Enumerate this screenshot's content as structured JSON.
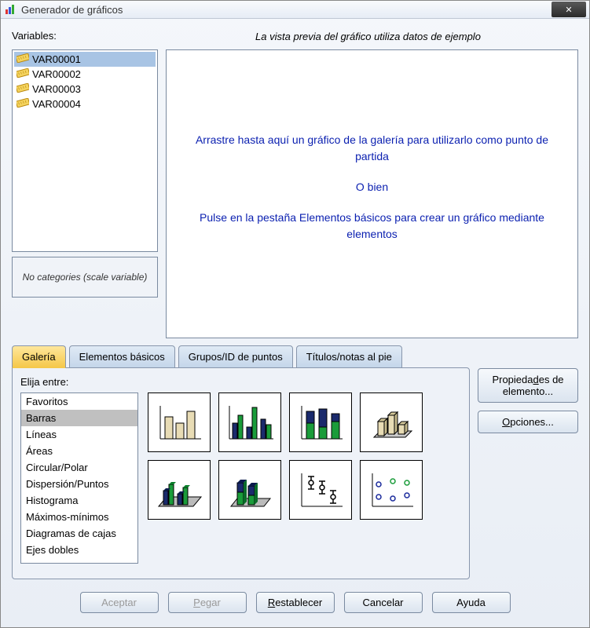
{
  "window": {
    "title": "Generador de gráficos"
  },
  "labels": {
    "variables": "Variables:",
    "preview_hint": "La vista previa del gráfico utiliza datos de ejemplo",
    "no_categories": "No categories (scale variable)",
    "choose_among": "Elija entre:"
  },
  "variables": [
    {
      "name": "VAR00001",
      "selected": true
    },
    {
      "name": "VAR00002",
      "selected": false
    },
    {
      "name": "VAR00003",
      "selected": false
    },
    {
      "name": "VAR00004",
      "selected": false
    }
  ],
  "preview_messages": {
    "drag": "Arrastre hasta aquí un gráfico de la galería para utilizarlo como punto de partida",
    "or": "O bien",
    "click": "Pulse en la pestaña Elementos básicos para crear un gráfico mediante elementos"
  },
  "tabs": [
    {
      "label": "Galería",
      "active": true
    },
    {
      "label": "Elementos básicos",
      "active": false
    },
    {
      "label": "Grupos/ID de puntos",
      "active": false
    },
    {
      "label": "Títulos/notas al pie",
      "active": false
    }
  ],
  "gallery_types": [
    {
      "label": "Favoritos",
      "selected": false
    },
    {
      "label": "Barras",
      "selected": true
    },
    {
      "label": "Líneas",
      "selected": false
    },
    {
      "label": "Áreas",
      "selected": false
    },
    {
      "label": "Circular/Polar",
      "selected": false
    },
    {
      "label": "Dispersión/Puntos",
      "selected": false
    },
    {
      "label": "Histograma",
      "selected": false
    },
    {
      "label": "Máximos-mínimos",
      "selected": false
    },
    {
      "label": "Diagramas de cajas",
      "selected": false
    },
    {
      "label": "Ejes dobles",
      "selected": false
    }
  ],
  "gallery_thumbs": [
    "simple-bar",
    "clustered-bar",
    "stacked-bar",
    "3d-bar",
    "3d-clustered-bar",
    "3d-stacked-bar",
    "error-bar",
    "scatter-dot"
  ],
  "side_buttons": {
    "element_props": "Propiedades de elemento...",
    "options": "Opciones..."
  },
  "bottom_buttons": {
    "accept": "Aceptar",
    "paste": "Pegar",
    "reset": "Restablecer",
    "cancel": "Cancelar",
    "help": "Ayuda"
  }
}
